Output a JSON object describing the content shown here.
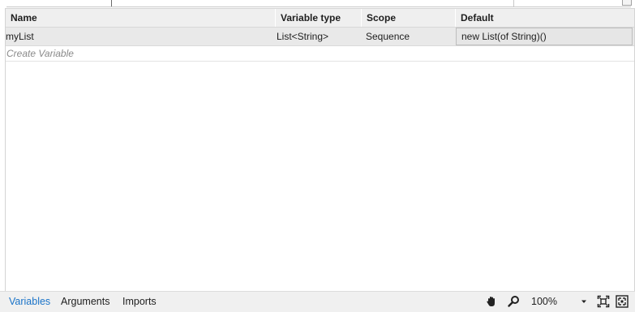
{
  "grid": {
    "headers": {
      "name": "Name",
      "variable_type": "Variable type",
      "scope": "Scope",
      "default": "Default"
    },
    "rows": [
      {
        "name": "myList",
        "variable_type": "List<String>",
        "scope": "Sequence",
        "default": "new List(of String)()"
      }
    ],
    "create_variable_label": "Create Variable"
  },
  "bottom_bar": {
    "tabs": [
      {
        "label": "Variables",
        "active": true
      },
      {
        "label": "Arguments",
        "active": false
      },
      {
        "label": "Imports",
        "active": false
      }
    ],
    "zoom_level": "100%",
    "icons": {
      "pan": "hand-icon",
      "zoom": "magnifier-icon",
      "zoom_dropdown": "chevron-down-icon",
      "fit": "fit-to-screen-icon",
      "overview": "overview-icon"
    }
  },
  "colors": {
    "active_tab": "#1a73c8",
    "header_bg": "#efefef",
    "row_bg": "#e9e9e9",
    "placeholder_text": "#8a8a8a"
  }
}
